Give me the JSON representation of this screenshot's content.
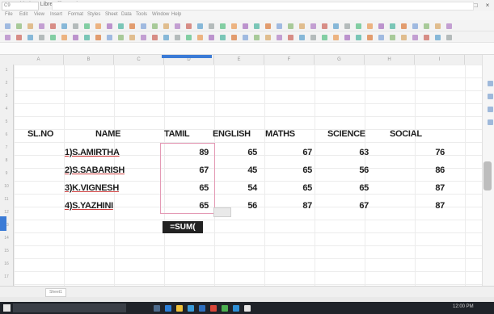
{
  "window": {
    "title": "Untitled 1 - LibreOffice Calc",
    "controls": [
      "–",
      "□",
      "×"
    ]
  },
  "menu": [
    "File",
    "Edit",
    "View",
    "Insert",
    "Format",
    "Styles",
    "Sheet",
    "Data",
    "Tools",
    "Window",
    "Help"
  ],
  "formula_bar": {
    "name_box": "C9",
    "formula": ""
  },
  "columns": [
    "A",
    "B",
    "C",
    "D",
    "E",
    "F",
    "G",
    "H",
    "I"
  ],
  "rows": [
    "1",
    "2",
    "3",
    "4",
    "5",
    "6",
    "7",
    "8",
    "9",
    "10",
    "11",
    "12",
    "13",
    "14",
    "15",
    "16",
    "17"
  ],
  "sheet": {
    "headers": [
      "SL.NO",
      "NAME",
      "TAMIL",
      "ENGLISH",
      "MATHS",
      "SCIENCE",
      "SOCIAL"
    ],
    "records": [
      {
        "name": "1)S.AMIRTHA",
        "tamil": "89",
        "english": "65",
        "maths": "67",
        "science": "63",
        "social": "76"
      },
      {
        "name": "2)S.SABARISH",
        "tamil": "67",
        "english": "45",
        "maths": "65",
        "science": "56",
        "social": "86"
      },
      {
        "name": "3)K.VIGNESH",
        "tamil": "65",
        "english": "54",
        "maths": "65",
        "science": "65",
        "social": "87"
      },
      {
        "name": "4)S.YAZHINI",
        "tamil": "65",
        "english": "56",
        "maths": "87",
        "science": "67",
        "social": "87"
      }
    ],
    "active_cell_text": "=SUM("
  },
  "tabs": {
    "sheet_tab": "Sheet1"
  },
  "taskbar": {
    "clock": "12:00 PM"
  }
}
